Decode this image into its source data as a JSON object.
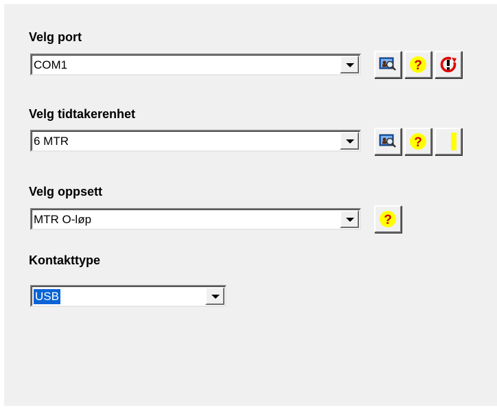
{
  "port": {
    "label": "Velg port",
    "value": "COM1"
  },
  "unit": {
    "label": "Velg tidtakerenhet",
    "value": "6 MTR"
  },
  "setup": {
    "label": "Velg oppsett",
    "value": "MTR O-løp"
  },
  "contact": {
    "label": "Kontakttype",
    "value": "USB"
  },
  "icons": {
    "find": "search-device-icon",
    "help": "question-mark-icon",
    "reset": "reset-icon",
    "status": "status-indicator-icon"
  },
  "colors": {
    "panel_bg": "#f0f0f0",
    "help_yellow": "#ffff00",
    "reset_red": "#e00000",
    "selection_blue": "#0a64d6"
  }
}
